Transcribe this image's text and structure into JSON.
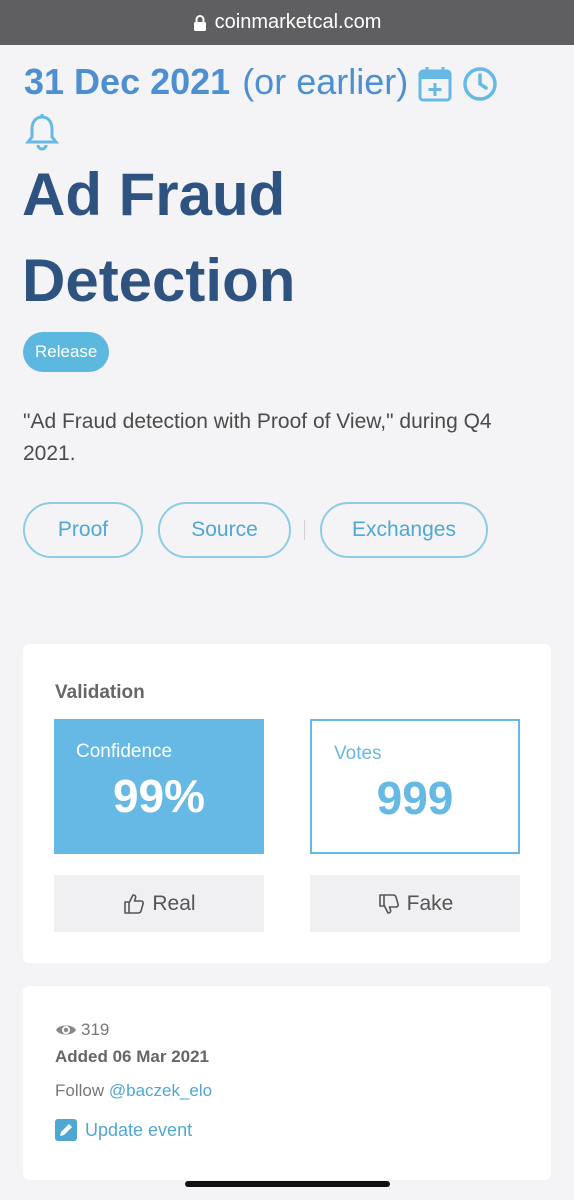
{
  "browser": {
    "url": "coinmarketcal.com"
  },
  "event": {
    "date": "31 Dec 2021",
    "date_qualifier": "(or earlier)",
    "title": "Ad Fraud Detection",
    "tag": "Release",
    "description": "\"Ad Fraud detection with Proof of View,\" during Q4 2021."
  },
  "actions": {
    "proof": "Proof",
    "source": "Source",
    "exchanges": "Exchanges"
  },
  "validation": {
    "heading": "Validation",
    "confidence_label": "Confidence",
    "confidence_value": "99%",
    "votes_label": "Votes",
    "votes_value": "999",
    "real_label": "Real",
    "fake_label": "Fake"
  },
  "meta": {
    "views": "319",
    "added": "Added 06 Mar 2021",
    "follow_prefix": "Follow",
    "follow_handle": "@baczek_elo",
    "update_label": "Update event"
  },
  "colors": {
    "accent": "#65b9e4",
    "title": "#2f5380",
    "date": "#4d8fd0"
  },
  "icons": [
    "lock-icon",
    "calendar-plus-icon",
    "clock-icon",
    "bell-icon",
    "thumbs-up-icon",
    "thumbs-down-icon",
    "eye-icon",
    "edit-icon"
  ]
}
